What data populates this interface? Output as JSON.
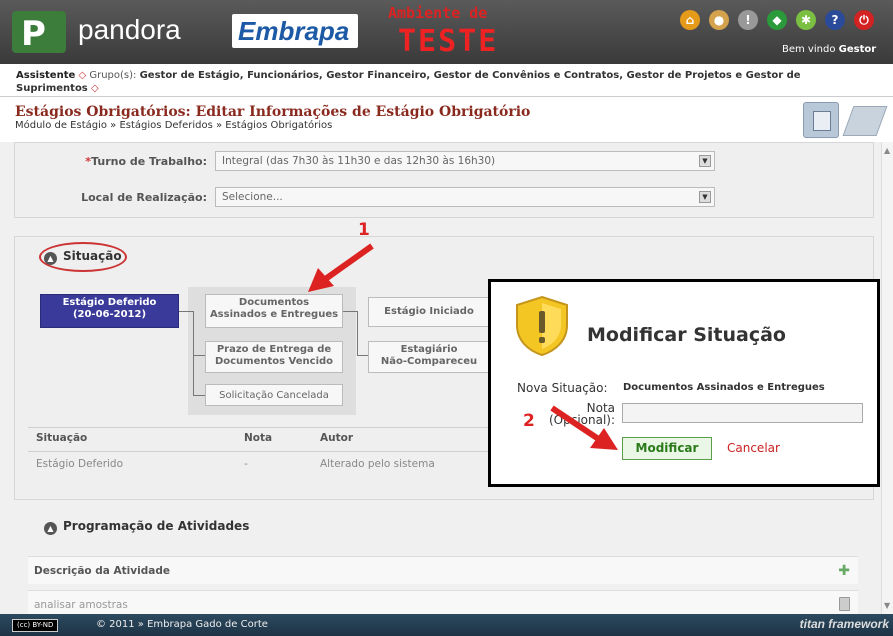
{
  "header": {
    "brand": "pandora",
    "embrapa": "Embrapa",
    "env_line1": "Ambiente de",
    "env_line2": "TESTE",
    "welcome_prefix": "Bem vindo",
    "welcome_user": "Gestor",
    "icons": [
      {
        "name": "home-icon",
        "glyph": "⌂",
        "color": "#e59a1a"
      },
      {
        "name": "user-icon",
        "glyph": "●",
        "color": "#d4a24c"
      },
      {
        "name": "alert-icon",
        "glyph": "!",
        "color": "#999999"
      },
      {
        "name": "brazil-flag-icon",
        "glyph": "◆",
        "color": "#2a9a3a"
      },
      {
        "name": "settings-icon",
        "glyph": "✱",
        "color": "#7bc043"
      },
      {
        "name": "help-icon",
        "glyph": "?",
        "color": "#2a4a9a"
      },
      {
        "name": "power-icon",
        "glyph": "⏻",
        "color": "#d22222"
      }
    ]
  },
  "assistant": {
    "label": "Assistente",
    "groups_prefix": "Grupo(s):",
    "groups": "Gestor de Estágio, Funcionários, Gestor Financeiro, Gestor de Convênios e Contratos, Gestor de Projetos e Gestor de",
    "groups_cont": "Suprimentos"
  },
  "page": {
    "title": "Estágios Obrigatórios: Editar Informações de Estágio Obrigatório",
    "breadcrumb": "Módulo de Estágio » Estágios Deferidos » Estágios Obrigatórios"
  },
  "form": {
    "turno_label": "Turno de Trabalho:",
    "turno_value": "Integral (das 7h30 às 11h30 e das 12h30 às 16h30)",
    "local_label": "Local de Realização:",
    "local_value": "Selecione..."
  },
  "situacao": {
    "title": "Situação",
    "current": "Estágio Deferido\n(20-06-2012)",
    "options": {
      "docs": "Documentos\nAssinados e Entregues",
      "prazo": "Prazo de Entrega de\nDocumentos Vencido",
      "cancel": "Solicitação Cancelada",
      "iniciado": "Estágio Iniciado",
      "naocomp": "Estagiário\nNão-Compareceu"
    },
    "table": {
      "headers": [
        "Situação",
        "Nota",
        "Autor"
      ],
      "rows": [
        [
          "Estágio Deferido",
          "-",
          "Alterado pelo sistema"
        ]
      ]
    }
  },
  "programacao": {
    "title": "Programação de Atividades",
    "header": "Descrição da Atividade",
    "rows": [
      "analisar amostras"
    ]
  },
  "modal": {
    "title": "Modificar Situação",
    "nova_label": "Nova Situação:",
    "nova_value": "Documentos Assinados e Entregues",
    "nota_label": "Nota\n(Opcional):",
    "submit": "Modificar",
    "cancel": "Cancelar"
  },
  "annotations": {
    "step1": "1",
    "step2": "2"
  },
  "footer": {
    "license": "BY-ND",
    "copyright": "© 2011 » Embrapa Gado de Corte",
    "framework": "titan framework"
  }
}
